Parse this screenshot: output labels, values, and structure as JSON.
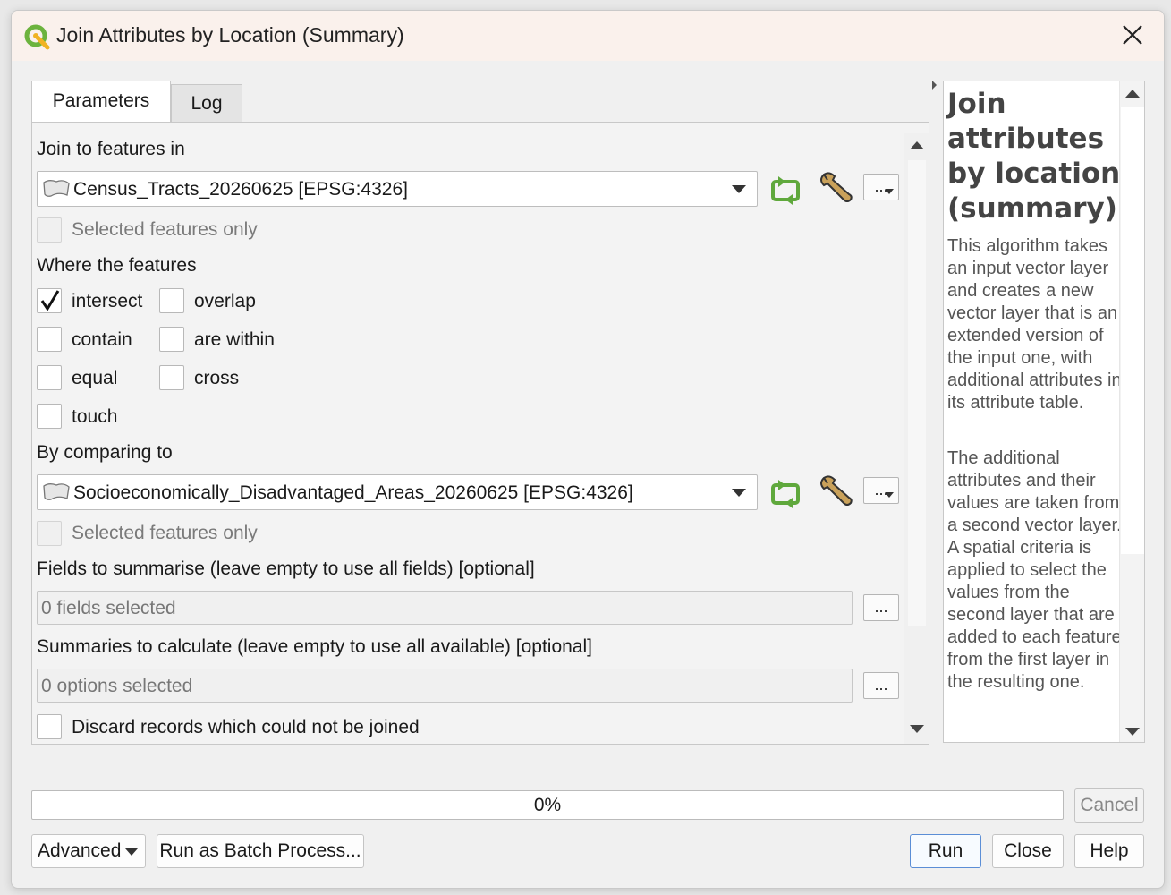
{
  "window": {
    "title": "Join Attributes by Location (Summary)"
  },
  "tabs": [
    {
      "label": "Parameters",
      "active": true
    },
    {
      "label": "Log",
      "active": false
    }
  ],
  "params": {
    "join_label": "Join to features in",
    "join_layer": "Census_Tracts_20260625 [EPSG:4326]",
    "join_selected_only": "Selected features only",
    "predicate_label": "Where the features",
    "predicates": [
      {
        "label": "intersect",
        "checked": true
      },
      {
        "label": "overlap",
        "checked": false
      },
      {
        "label": "contain",
        "checked": false
      },
      {
        "label": "are within",
        "checked": false
      },
      {
        "label": "equal",
        "checked": false
      },
      {
        "label": "cross",
        "checked": false
      },
      {
        "label": "touch",
        "checked": false
      }
    ],
    "compare_label": "By comparing to",
    "compare_layer": "Socioeconomically_Disadvantaged_Areas_20260625 [EPSG:4326]",
    "compare_selected_only": "Selected features only",
    "fields_label": "Fields to summarise (leave empty to use all fields) [optional]",
    "fields_value": "0 fields selected",
    "summaries_label": "Summaries to calculate (leave empty to use all available) [optional]",
    "summaries_value": "0 options selected",
    "discard_label": "Discard records which could not be joined",
    "dots": "..."
  },
  "help": {
    "title": "Join attributes by location (summary)",
    "para1": "This algorithm takes an input vector layer and creates a new vector layer that is an extended version of the input one, with additional attributes in its attribute table.",
    "para2": "The additional attributes and their values are taken from a second vector layer. A spatial criteria is applied to select the values from the second layer that are added to each feature from the first layer in the resulting one."
  },
  "footer": {
    "progress_text": "0%",
    "progress_value": 0,
    "cancel": "Cancel",
    "advanced": "Advanced",
    "batch": "Run as Batch Process...",
    "run": "Run",
    "close": "Close",
    "help": "Help"
  },
  "colors": {
    "accent_green": "#5fa83c",
    "default_button_border": "#5b8ed6"
  }
}
